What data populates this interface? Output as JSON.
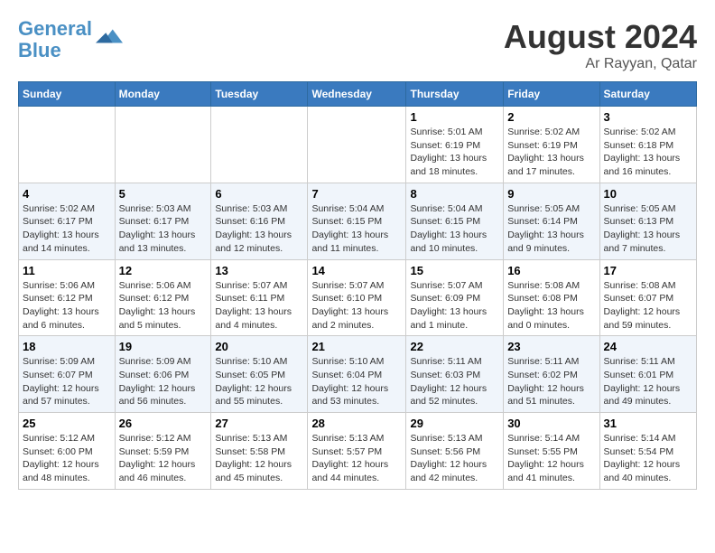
{
  "logo": {
    "line1": "General",
    "line2": "Blue"
  },
  "title": "August 2024",
  "subtitle": "Ar Rayyan, Qatar",
  "weekdays": [
    "Sunday",
    "Monday",
    "Tuesday",
    "Wednesday",
    "Thursday",
    "Friday",
    "Saturday"
  ],
  "weeks": [
    [
      {
        "day": "",
        "info": ""
      },
      {
        "day": "",
        "info": ""
      },
      {
        "day": "",
        "info": ""
      },
      {
        "day": "",
        "info": ""
      },
      {
        "day": "1",
        "info": "Sunrise: 5:01 AM\nSunset: 6:19 PM\nDaylight: 13 hours\nand 18 minutes."
      },
      {
        "day": "2",
        "info": "Sunrise: 5:02 AM\nSunset: 6:19 PM\nDaylight: 13 hours\nand 17 minutes."
      },
      {
        "day": "3",
        "info": "Sunrise: 5:02 AM\nSunset: 6:18 PM\nDaylight: 13 hours\nand 16 minutes."
      }
    ],
    [
      {
        "day": "4",
        "info": "Sunrise: 5:02 AM\nSunset: 6:17 PM\nDaylight: 13 hours\nand 14 minutes."
      },
      {
        "day": "5",
        "info": "Sunrise: 5:03 AM\nSunset: 6:17 PM\nDaylight: 13 hours\nand 13 minutes."
      },
      {
        "day": "6",
        "info": "Sunrise: 5:03 AM\nSunset: 6:16 PM\nDaylight: 13 hours\nand 12 minutes."
      },
      {
        "day": "7",
        "info": "Sunrise: 5:04 AM\nSunset: 6:15 PM\nDaylight: 13 hours\nand 11 minutes."
      },
      {
        "day": "8",
        "info": "Sunrise: 5:04 AM\nSunset: 6:15 PM\nDaylight: 13 hours\nand 10 minutes."
      },
      {
        "day": "9",
        "info": "Sunrise: 5:05 AM\nSunset: 6:14 PM\nDaylight: 13 hours\nand 9 minutes."
      },
      {
        "day": "10",
        "info": "Sunrise: 5:05 AM\nSunset: 6:13 PM\nDaylight: 13 hours\nand 7 minutes."
      }
    ],
    [
      {
        "day": "11",
        "info": "Sunrise: 5:06 AM\nSunset: 6:12 PM\nDaylight: 13 hours\nand 6 minutes."
      },
      {
        "day": "12",
        "info": "Sunrise: 5:06 AM\nSunset: 6:12 PM\nDaylight: 13 hours\nand 5 minutes."
      },
      {
        "day": "13",
        "info": "Sunrise: 5:07 AM\nSunset: 6:11 PM\nDaylight: 13 hours\nand 4 minutes."
      },
      {
        "day": "14",
        "info": "Sunrise: 5:07 AM\nSunset: 6:10 PM\nDaylight: 13 hours\nand 2 minutes."
      },
      {
        "day": "15",
        "info": "Sunrise: 5:07 AM\nSunset: 6:09 PM\nDaylight: 13 hours\nand 1 minute."
      },
      {
        "day": "16",
        "info": "Sunrise: 5:08 AM\nSunset: 6:08 PM\nDaylight: 13 hours\nand 0 minutes."
      },
      {
        "day": "17",
        "info": "Sunrise: 5:08 AM\nSunset: 6:07 PM\nDaylight: 12 hours\nand 59 minutes."
      }
    ],
    [
      {
        "day": "18",
        "info": "Sunrise: 5:09 AM\nSunset: 6:07 PM\nDaylight: 12 hours\nand 57 minutes."
      },
      {
        "day": "19",
        "info": "Sunrise: 5:09 AM\nSunset: 6:06 PM\nDaylight: 12 hours\nand 56 minutes."
      },
      {
        "day": "20",
        "info": "Sunrise: 5:10 AM\nSunset: 6:05 PM\nDaylight: 12 hours\nand 55 minutes."
      },
      {
        "day": "21",
        "info": "Sunrise: 5:10 AM\nSunset: 6:04 PM\nDaylight: 12 hours\nand 53 minutes."
      },
      {
        "day": "22",
        "info": "Sunrise: 5:11 AM\nSunset: 6:03 PM\nDaylight: 12 hours\nand 52 minutes."
      },
      {
        "day": "23",
        "info": "Sunrise: 5:11 AM\nSunset: 6:02 PM\nDaylight: 12 hours\nand 51 minutes."
      },
      {
        "day": "24",
        "info": "Sunrise: 5:11 AM\nSunset: 6:01 PM\nDaylight: 12 hours\nand 49 minutes."
      }
    ],
    [
      {
        "day": "25",
        "info": "Sunrise: 5:12 AM\nSunset: 6:00 PM\nDaylight: 12 hours\nand 48 minutes."
      },
      {
        "day": "26",
        "info": "Sunrise: 5:12 AM\nSunset: 5:59 PM\nDaylight: 12 hours\nand 46 minutes."
      },
      {
        "day": "27",
        "info": "Sunrise: 5:13 AM\nSunset: 5:58 PM\nDaylight: 12 hours\nand 45 minutes."
      },
      {
        "day": "28",
        "info": "Sunrise: 5:13 AM\nSunset: 5:57 PM\nDaylight: 12 hours\nand 44 minutes."
      },
      {
        "day": "29",
        "info": "Sunrise: 5:13 AM\nSunset: 5:56 PM\nDaylight: 12 hours\nand 42 minutes."
      },
      {
        "day": "30",
        "info": "Sunrise: 5:14 AM\nSunset: 5:55 PM\nDaylight: 12 hours\nand 41 minutes."
      },
      {
        "day": "31",
        "info": "Sunrise: 5:14 AM\nSunset: 5:54 PM\nDaylight: 12 hours\nand 40 minutes."
      }
    ]
  ]
}
